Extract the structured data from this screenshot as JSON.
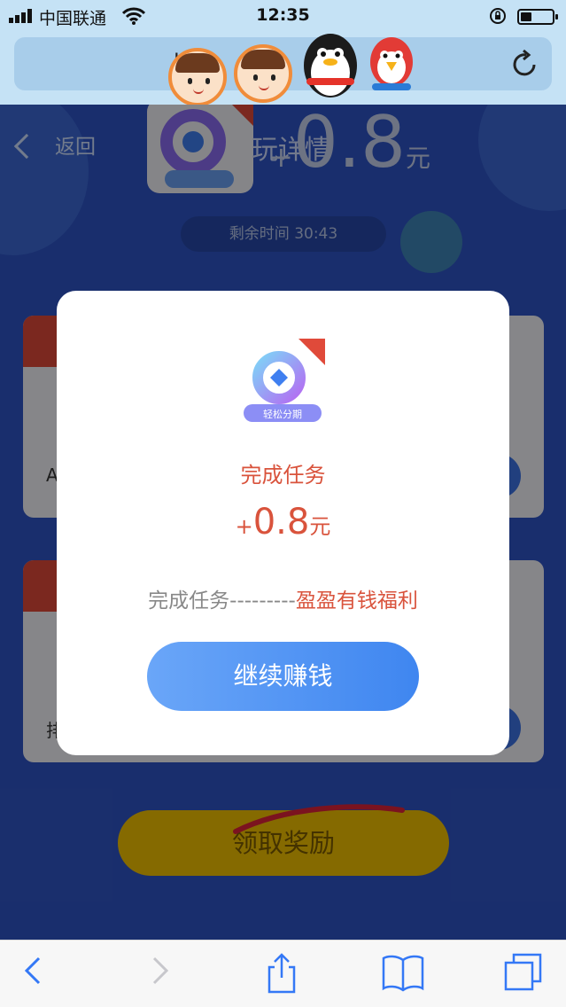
{
  "status_bar": {
    "carrier": "中国联通",
    "time": "12:35"
  },
  "browser": {
    "url_text": "l  ia"
  },
  "page": {
    "back_label": "返回",
    "title": "玩详情",
    "reward": {
      "plus": "+",
      "value": "0.8",
      "unit": "元"
    },
    "timer": "剩余时间 30:43",
    "card1_peek": "A",
    "card2_peek": "排",
    "claim_button": "领取奖励"
  },
  "modal": {
    "logo_text": "轻松分期",
    "title": "完成任务",
    "amount": {
      "plus": "+",
      "value": "0.8",
      "unit": "元"
    },
    "line_prefix": "完成任务---------",
    "line_highlight": "盈盈有钱福利",
    "continue_button": "继续赚钱"
  },
  "colors": {
    "accent_red": "#d9533c",
    "button_blue": "#3f86f0",
    "claim_yellow": "#f2c200",
    "page_blue": "#2f55c6"
  }
}
